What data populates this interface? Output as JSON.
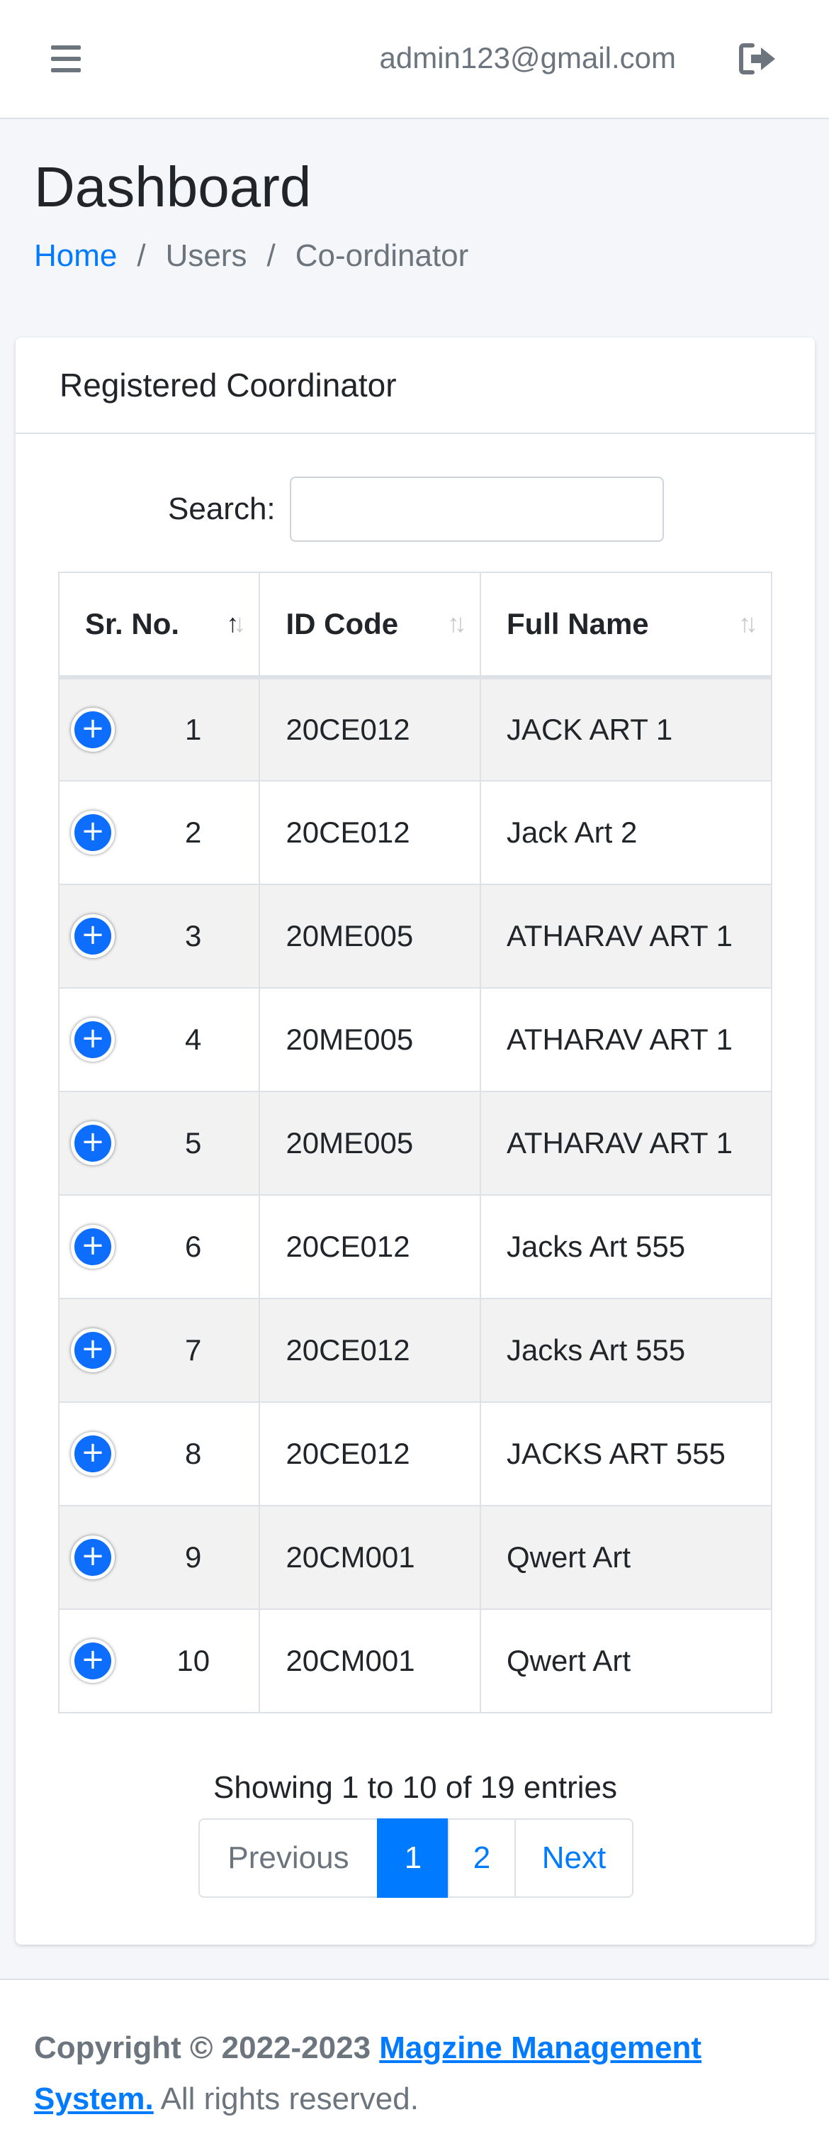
{
  "topbar": {
    "email": "admin123@gmail.com"
  },
  "page": {
    "title": "Dashboard"
  },
  "breadcrumb": {
    "home": "Home",
    "sep": "/",
    "users": "Users",
    "current": "Co-ordinator"
  },
  "card": {
    "title": "Registered Coordinator"
  },
  "search": {
    "label": "Search:",
    "value": ""
  },
  "table": {
    "headers": [
      "Sr. No.",
      "ID Code",
      "Full Name"
    ],
    "rows": [
      [
        "1",
        "20CE012",
        "JACK ART 1"
      ],
      [
        "2",
        "20CE012",
        "Jack Art 2"
      ],
      [
        "3",
        "20ME005",
        "ATHARAV ART 1"
      ],
      [
        "4",
        "20ME005",
        "ATHARAV ART 1"
      ],
      [
        "5",
        "20ME005",
        "ATHARAV ART 1"
      ],
      [
        "6",
        "20CE012",
        "Jacks Art 555"
      ],
      [
        "7",
        "20CE012",
        "Jacks Art 555"
      ],
      [
        "8",
        "20CE012",
        "JACKS ART 555"
      ],
      [
        "9",
        "20CM001",
        "Qwert Art"
      ],
      [
        "10",
        "20CM001",
        "Qwert Art"
      ]
    ],
    "expand_symbol": "+"
  },
  "pagination": {
    "info": "Showing 1 to 10 of 19 entries",
    "previous": "Previous",
    "pages": [
      "1",
      "2"
    ],
    "next": "Next"
  },
  "footer": {
    "prefix": "Copyright © 2022-2023 ",
    "brand": "Magzine Management System.",
    "suffix": " All rights reserved."
  },
  "colors": {
    "primary": "#007bff",
    "muted": "#6c757d",
    "striped_row": "#f2f2f2"
  }
}
